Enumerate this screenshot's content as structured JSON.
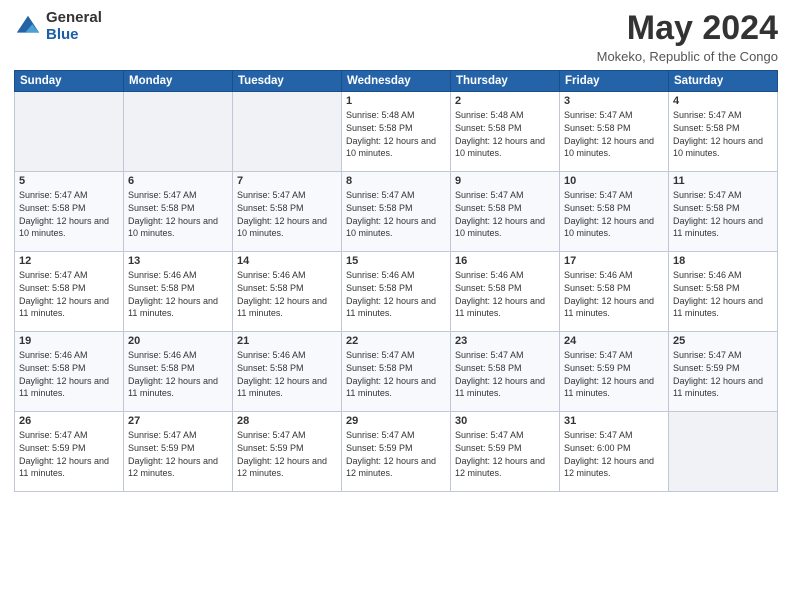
{
  "header": {
    "logo_general": "General",
    "logo_blue": "Blue",
    "month_title": "May 2024",
    "location": "Mokeko, Republic of the Congo"
  },
  "weekdays": [
    "Sunday",
    "Monday",
    "Tuesday",
    "Wednesday",
    "Thursday",
    "Friday",
    "Saturday"
  ],
  "weeks": [
    [
      {
        "day": "",
        "empty": true
      },
      {
        "day": "",
        "empty": true
      },
      {
        "day": "",
        "empty": true
      },
      {
        "day": "1",
        "sunrise": "5:48 AM",
        "sunset": "5:58 PM",
        "daylight": "12 hours and 10 minutes."
      },
      {
        "day": "2",
        "sunrise": "5:48 AM",
        "sunset": "5:58 PM",
        "daylight": "12 hours and 10 minutes."
      },
      {
        "day": "3",
        "sunrise": "5:47 AM",
        "sunset": "5:58 PM",
        "daylight": "12 hours and 10 minutes."
      },
      {
        "day": "4",
        "sunrise": "5:47 AM",
        "sunset": "5:58 PM",
        "daylight": "12 hours and 10 minutes."
      }
    ],
    [
      {
        "day": "5",
        "sunrise": "5:47 AM",
        "sunset": "5:58 PM",
        "daylight": "12 hours and 10 minutes."
      },
      {
        "day": "6",
        "sunrise": "5:47 AM",
        "sunset": "5:58 PM",
        "daylight": "12 hours and 10 minutes."
      },
      {
        "day": "7",
        "sunrise": "5:47 AM",
        "sunset": "5:58 PM",
        "daylight": "12 hours and 10 minutes."
      },
      {
        "day": "8",
        "sunrise": "5:47 AM",
        "sunset": "5:58 PM",
        "daylight": "12 hours and 10 minutes."
      },
      {
        "day": "9",
        "sunrise": "5:47 AM",
        "sunset": "5:58 PM",
        "daylight": "12 hours and 10 minutes."
      },
      {
        "day": "10",
        "sunrise": "5:47 AM",
        "sunset": "5:58 PM",
        "daylight": "12 hours and 10 minutes."
      },
      {
        "day": "11",
        "sunrise": "5:47 AM",
        "sunset": "5:58 PM",
        "daylight": "12 hours and 11 minutes."
      }
    ],
    [
      {
        "day": "12",
        "sunrise": "5:47 AM",
        "sunset": "5:58 PM",
        "daylight": "12 hours and 11 minutes."
      },
      {
        "day": "13",
        "sunrise": "5:46 AM",
        "sunset": "5:58 PM",
        "daylight": "12 hours and 11 minutes."
      },
      {
        "day": "14",
        "sunrise": "5:46 AM",
        "sunset": "5:58 PM",
        "daylight": "12 hours and 11 minutes."
      },
      {
        "day": "15",
        "sunrise": "5:46 AM",
        "sunset": "5:58 PM",
        "daylight": "12 hours and 11 minutes."
      },
      {
        "day": "16",
        "sunrise": "5:46 AM",
        "sunset": "5:58 PM",
        "daylight": "12 hours and 11 minutes."
      },
      {
        "day": "17",
        "sunrise": "5:46 AM",
        "sunset": "5:58 PM",
        "daylight": "12 hours and 11 minutes."
      },
      {
        "day": "18",
        "sunrise": "5:46 AM",
        "sunset": "5:58 PM",
        "daylight": "12 hours and 11 minutes."
      }
    ],
    [
      {
        "day": "19",
        "sunrise": "5:46 AM",
        "sunset": "5:58 PM",
        "daylight": "12 hours and 11 minutes."
      },
      {
        "day": "20",
        "sunrise": "5:46 AM",
        "sunset": "5:58 PM",
        "daylight": "12 hours and 11 minutes."
      },
      {
        "day": "21",
        "sunrise": "5:46 AM",
        "sunset": "5:58 PM",
        "daylight": "12 hours and 11 minutes."
      },
      {
        "day": "22",
        "sunrise": "5:47 AM",
        "sunset": "5:58 PM",
        "daylight": "12 hours and 11 minutes."
      },
      {
        "day": "23",
        "sunrise": "5:47 AM",
        "sunset": "5:58 PM",
        "daylight": "12 hours and 11 minutes."
      },
      {
        "day": "24",
        "sunrise": "5:47 AM",
        "sunset": "5:59 PM",
        "daylight": "12 hours and 11 minutes."
      },
      {
        "day": "25",
        "sunrise": "5:47 AM",
        "sunset": "5:59 PM",
        "daylight": "12 hours and 11 minutes."
      }
    ],
    [
      {
        "day": "26",
        "sunrise": "5:47 AM",
        "sunset": "5:59 PM",
        "daylight": "12 hours and 11 minutes."
      },
      {
        "day": "27",
        "sunrise": "5:47 AM",
        "sunset": "5:59 PM",
        "daylight": "12 hours and 12 minutes."
      },
      {
        "day": "28",
        "sunrise": "5:47 AM",
        "sunset": "5:59 PM",
        "daylight": "12 hours and 12 minutes."
      },
      {
        "day": "29",
        "sunrise": "5:47 AM",
        "sunset": "5:59 PM",
        "daylight": "12 hours and 12 minutes."
      },
      {
        "day": "30",
        "sunrise": "5:47 AM",
        "sunset": "5:59 PM",
        "daylight": "12 hours and 12 minutes."
      },
      {
        "day": "31",
        "sunrise": "5:47 AM",
        "sunset": "6:00 PM",
        "daylight": "12 hours and 12 minutes."
      },
      {
        "day": "",
        "empty": true
      }
    ]
  ],
  "labels": {
    "sunrise_prefix": "Sunrise: ",
    "sunset_prefix": "Sunset: ",
    "daylight_prefix": "Daylight: "
  }
}
